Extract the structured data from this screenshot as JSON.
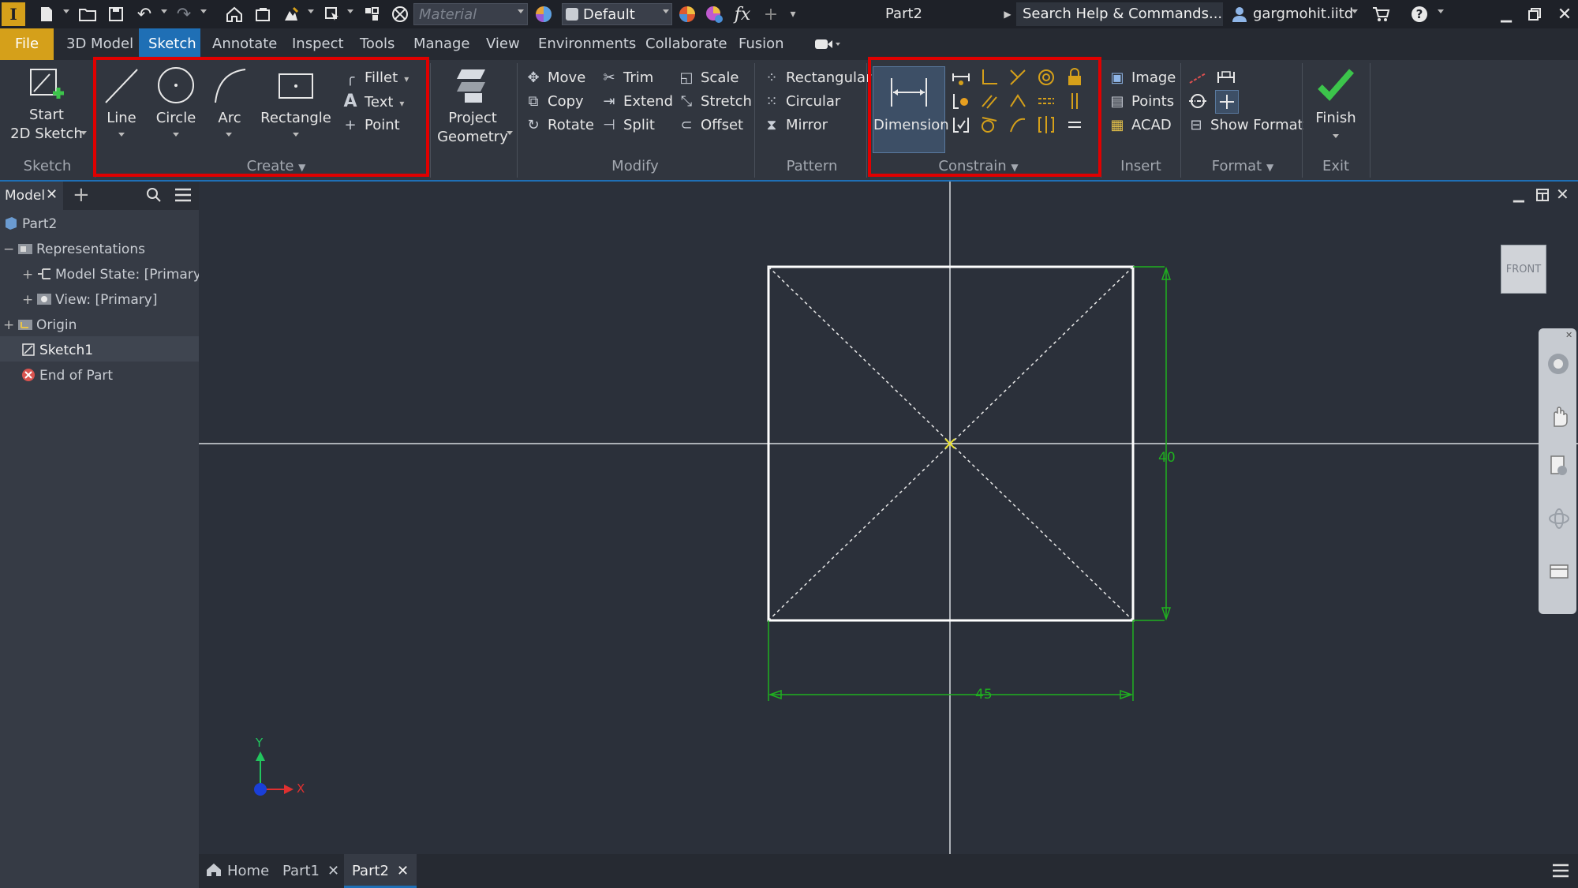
{
  "titlebar": {
    "material_placeholder": "Material",
    "appearance_value": "Default",
    "document_title": "Part2",
    "search_placeholder": "Search Help & Commands...",
    "user_name": "gargmohit.iitd"
  },
  "menu": {
    "tabs": [
      "File",
      "3D Model",
      "Sketch",
      "Annotate",
      "Inspect",
      "Tools",
      "Manage",
      "View",
      "Environments",
      "Collaborate",
      "Fusion"
    ],
    "active": "Sketch"
  },
  "ribbon": {
    "sketch_panel": {
      "title": "Sketch",
      "start_label_1": "Start",
      "start_label_2": "2D Sketch"
    },
    "create_panel": {
      "title": "Create",
      "line": "Line",
      "circle": "Circle",
      "arc": "Arc",
      "rectangle": "Rectangle",
      "fillet": "Fillet",
      "text": "Text",
      "point": "Point"
    },
    "project_geometry": {
      "label_1": "Project",
      "label_2": "Geometry"
    },
    "modify_panel": {
      "title": "Modify",
      "move": "Move",
      "copy": "Copy",
      "rotate": "Rotate",
      "trim": "Trim",
      "extend": "Extend",
      "split": "Split",
      "scale": "Scale",
      "stretch": "Stretch",
      "offset": "Offset"
    },
    "pattern_panel": {
      "title": "Pattern",
      "rectangular": "Rectangular",
      "circular": "Circular",
      "mirror": "Mirror"
    },
    "constrain_panel": {
      "title": "Constrain",
      "dimension": "Dimension"
    },
    "insert_panel": {
      "title": "Insert",
      "image": "Image",
      "points": "Points",
      "acad": "ACAD"
    },
    "format_panel": {
      "title": "Format",
      "show_format": "Show Format"
    },
    "exit_panel": {
      "title": "Exit",
      "finish": "Finish"
    }
  },
  "browser": {
    "tab_label": "Model",
    "items": [
      {
        "label": "Part2"
      },
      {
        "label": "Representations"
      },
      {
        "label": "Model State: [Primary]"
      },
      {
        "label": "View: [Primary]"
      },
      {
        "label": "Origin"
      },
      {
        "label": "Sketch1"
      },
      {
        "label": "End of Part"
      }
    ]
  },
  "canvas": {
    "viewcube_label": "FRONT",
    "dimension_height": "40",
    "dimension_width": "45",
    "axis_x": "X",
    "axis_y": "Y"
  },
  "document_tabs": {
    "home": "Home",
    "tabs": [
      "Part1",
      "Part2"
    ],
    "active": "Part2"
  },
  "colors": {
    "accent": "#1f6fb5",
    "file_tab": "#d5a01a",
    "highlight_box": "#e00000",
    "dimension_green": "#1fb01f",
    "finish_check": "#3cc44b"
  }
}
